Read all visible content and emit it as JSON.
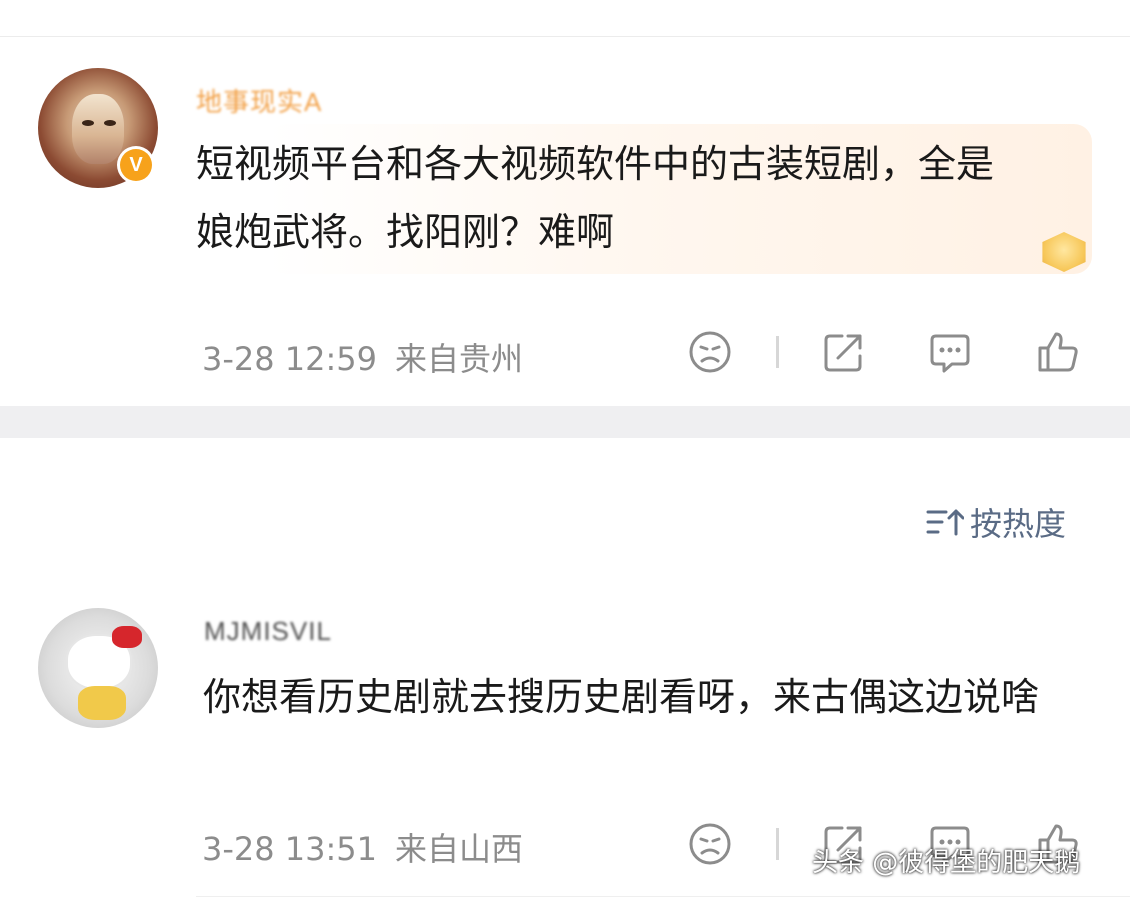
{
  "comments": [
    {
      "username": "地事现实A",
      "text": "短视频平台和各大视频软件中的古装短剧，全是娘炮武将。找阳刚？难啊",
      "time": "3-28 12:59",
      "location": "来自贵州",
      "verified_badge": "V"
    },
    {
      "username": "MJMISVIL",
      "text": "你想看历史剧就去搜历史剧看呀，来古偶这边说啥",
      "time": "3-28 13:51",
      "location": "来自山西"
    }
  ],
  "sort": {
    "label": "按热度"
  },
  "watermark": "头条 @彼得堡的肥天鹅",
  "icons": {
    "dislike": "sad-face-icon",
    "share": "share-icon",
    "comment": "comment-icon",
    "like": "thumbs-up-icon",
    "sort": "sort-icon"
  },
  "colors": {
    "text": "#1a1a1a",
    "meta": "#8c8c8c",
    "username_verified": "#f2a24a",
    "sort": "#5a6b85",
    "verified_badge": "#f7a21b"
  }
}
